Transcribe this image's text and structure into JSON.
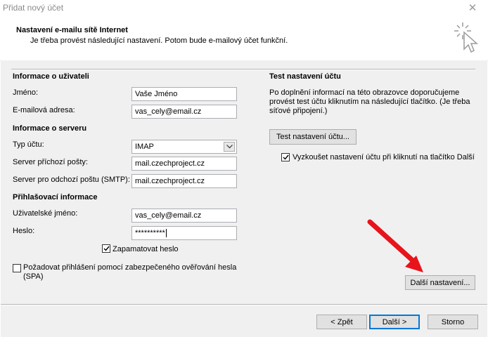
{
  "window": {
    "title": "Přidat nový účet",
    "close_glyph": "✕"
  },
  "header": {
    "title": "Nastavení e-mailu sítě Internet",
    "subtitle": "Je třeba provést následující nastavení. Potom bude e-mailový účet funkční.",
    "icon": "wizard-cursor-icon"
  },
  "user_info": {
    "heading": "Informace o uživateli",
    "name_label": "Jméno:",
    "name_value": "Vaše Jméno",
    "email_label": "E-mailová adresa:",
    "email_value": "vas_cely@email.cz"
  },
  "server_info": {
    "heading": "Informace o serveru",
    "account_type_label": "Typ účtu:",
    "account_type_value": "IMAP",
    "incoming_label": "Server příchozí pošty:",
    "incoming_value": "mail.czechproject.cz",
    "outgoing_label": "Server pro odchozí poštu (SMTP):",
    "outgoing_value": "mail.czechproject.cz"
  },
  "login_info": {
    "heading": "Přihlašovací informace",
    "username_label": "Uživatelské jméno:",
    "username_value": "vas_cely@email.cz",
    "password_label": "Heslo:",
    "password_value": "**********",
    "remember_label": "Zapamatovat heslo",
    "remember_checked": true,
    "spa_label": "Požadovat přihlášení pomocí zabezpečeného ověřování hesla (SPA)",
    "spa_checked": false
  },
  "test": {
    "heading": "Test nastavení účtu",
    "description": "Po doplnění informací na této obrazovce doporučujeme provést test účtu kliknutím na následující tlačítko. (Je třeba síťové připojení.)",
    "test_button": "Test nastavení účtu...",
    "auto_test_label": "Vyzkoušet nastavení účtu při kliknutí na tlačítko Další",
    "auto_test_checked": true
  },
  "more_settings_button": "Další nastavení...",
  "footer": {
    "back": "< Zpět",
    "next": "Další >",
    "cancel": "Storno"
  },
  "colors": {
    "accent": "#0078d7",
    "arrow": "#e8131b",
    "dialog_bg": "#f0f0f0"
  }
}
